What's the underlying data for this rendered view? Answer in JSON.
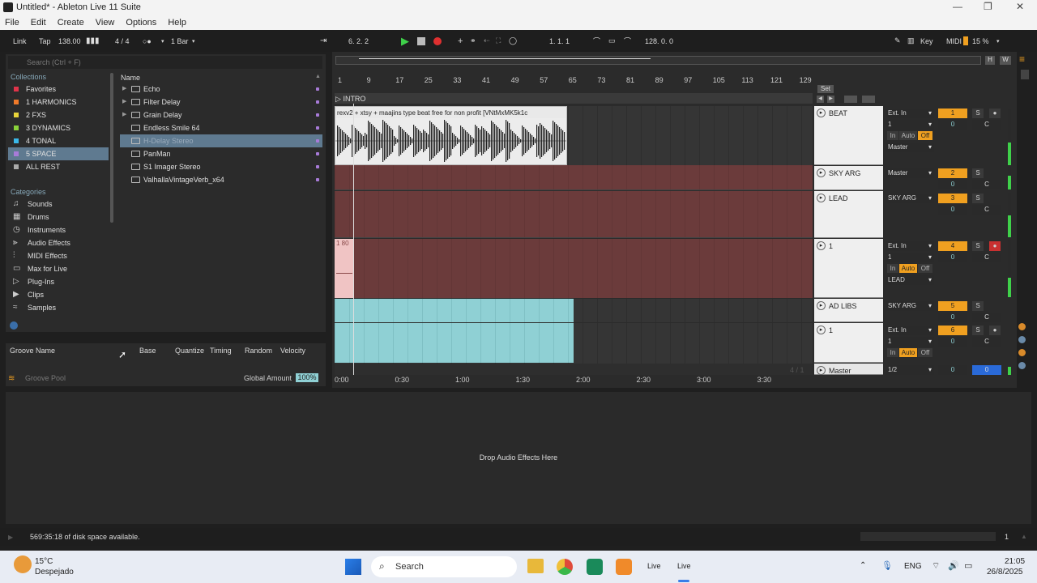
{
  "window": {
    "title": "Untitled* - Ableton Live 11 Suite"
  },
  "menu": [
    "File",
    "Edit",
    "Create",
    "View",
    "Options",
    "Help"
  ],
  "transport": {
    "link": "Link",
    "tap": "Tap",
    "tempo": "138.00",
    "signature": "4 / 4",
    "quantize": "1 Bar",
    "position": "6.  2.  2",
    "loop_start": "1.  1.  1",
    "loop_length": "128.  0.  0",
    "key": "Key",
    "midi": "MIDI",
    "cpu": "15 %"
  },
  "browser": {
    "search_placeholder": "Search (Ctrl + F)",
    "collections_header": "Collections",
    "collections": [
      {
        "label": "Favorites",
        "color": "#e0344a"
      },
      {
        "label": "1 HARMONICS",
        "color": "#f07a2a"
      },
      {
        "label": "2 FXS",
        "color": "#e8d43a"
      },
      {
        "label": "3 DYNAMICS",
        "color": "#8ad23a"
      },
      {
        "label": "4 TONAL",
        "color": "#3ab8e8"
      },
      {
        "label": "5 SPACE",
        "color": "#a87bd8"
      },
      {
        "label": "ALL REST",
        "color": "#aaaaaa"
      }
    ],
    "selected_collection": "5 SPACE",
    "categories_header": "Categories",
    "categories": [
      {
        "label": "Sounds",
        "icon": "♫"
      },
      {
        "label": "Drums",
        "icon": "▦"
      },
      {
        "label": "Instruments",
        "icon": "◷"
      },
      {
        "label": "Audio Effects",
        "icon": "⫸"
      },
      {
        "label": "MIDI Effects",
        "icon": "⫶"
      },
      {
        "label": "Max for Live",
        "icon": "▭"
      },
      {
        "label": "Plug-Ins",
        "icon": "▷"
      },
      {
        "label": "Clips",
        "icon": "▶"
      },
      {
        "label": "Samples",
        "icon": "≈"
      }
    ],
    "name_header": "Name",
    "items": [
      {
        "label": "Echo",
        "folder": true
      },
      {
        "label": "Filter Delay",
        "folder": true
      },
      {
        "label": "Grain Delay",
        "folder": true
      },
      {
        "label": "Endless Smile 64",
        "folder": false
      },
      {
        "label": "H-Delay Stereo",
        "folder": false
      },
      {
        "label": "PanMan",
        "folder": false
      },
      {
        "label": "S1 Imager Stereo",
        "folder": false
      },
      {
        "label": "ValhallaVintageVerb_x64",
        "folder": false
      }
    ],
    "selected_item": "H-Delay Stereo"
  },
  "groove": {
    "headers": [
      "Groove Name",
      "Base",
      "Quantize",
      "Timing",
      "Random",
      "Velocity"
    ],
    "pool_label": "Groove Pool",
    "global_amount_label": "Global Amount",
    "global_amount": "100%"
  },
  "arrangement": {
    "bar_ruler": [
      "1",
      "9",
      "17",
      "25",
      "33",
      "41",
      "49",
      "57",
      "65",
      "73",
      "81",
      "89",
      "97",
      "105",
      "113",
      "121",
      "129"
    ],
    "time_ruler": [
      "0:00",
      "0:30",
      "1:00",
      "1:30",
      "2:00",
      "2:30",
      "3:00",
      "3:30"
    ],
    "locator": "INTRO",
    "clip_name": "rexv2 + xtsy   + maajins type beat   free for non profit   [VNtMxMK5k1c",
    "pink_clip_label": "1 80",
    "set_label": "Set",
    "page_indicator": "4 / 1"
  },
  "tracks": [
    {
      "name": "BEAT",
      "input": "Ext. In",
      "channel": "1",
      "output": "Master",
      "number": "1",
      "volume": "0",
      "pan": "C",
      "color": "#f0a020",
      "monitor": [
        "In",
        "Auto",
        "Off"
      ]
    },
    {
      "name": "SKY ARG",
      "output": "Master",
      "number": "2",
      "volume": "0",
      "pan": "C",
      "color": "#f0a020"
    },
    {
      "name": "LEAD",
      "output": "SKY ARG",
      "number": "3",
      "volume": "0",
      "pan": "C",
      "color": "#f0a020"
    },
    {
      "name": "1",
      "input": "Ext. In",
      "channel": "1",
      "output": "LEAD",
      "number": "4",
      "volume": "0",
      "pan": "C",
      "color": "#f0a020",
      "monitor": [
        "In",
        "Auto",
        "Off"
      ]
    },
    {
      "name": "AD LIBS",
      "output": "SKY ARG",
      "number": "5",
      "volume": "0",
      "pan": "C",
      "color": "#f0a020"
    },
    {
      "name": "1",
      "input": "Ext. In",
      "channel": "1",
      "number": "6",
      "volume": "0",
      "pan": "C",
      "color": "#f0a020",
      "monitor": [
        "In",
        "Auto",
        "Off"
      ]
    },
    {
      "name": "Master",
      "output": "1/2",
      "volume": "0",
      "pan": "0"
    }
  ],
  "device_panel": {
    "drop_text": "Drop Audio Effects Here"
  },
  "status": {
    "disk": "569:35:18 of disk space available.",
    "page": "1"
  },
  "taskbar": {
    "temp": "15°C",
    "weather": "Despejado",
    "search": "Search",
    "lang": "ENG",
    "time": "21:05",
    "date": "26/8/2025"
  },
  "colors": {
    "accent": "#f0a020",
    "teal_clip": "#8fd0d4",
    "red_clip": "#6b3b3b"
  }
}
